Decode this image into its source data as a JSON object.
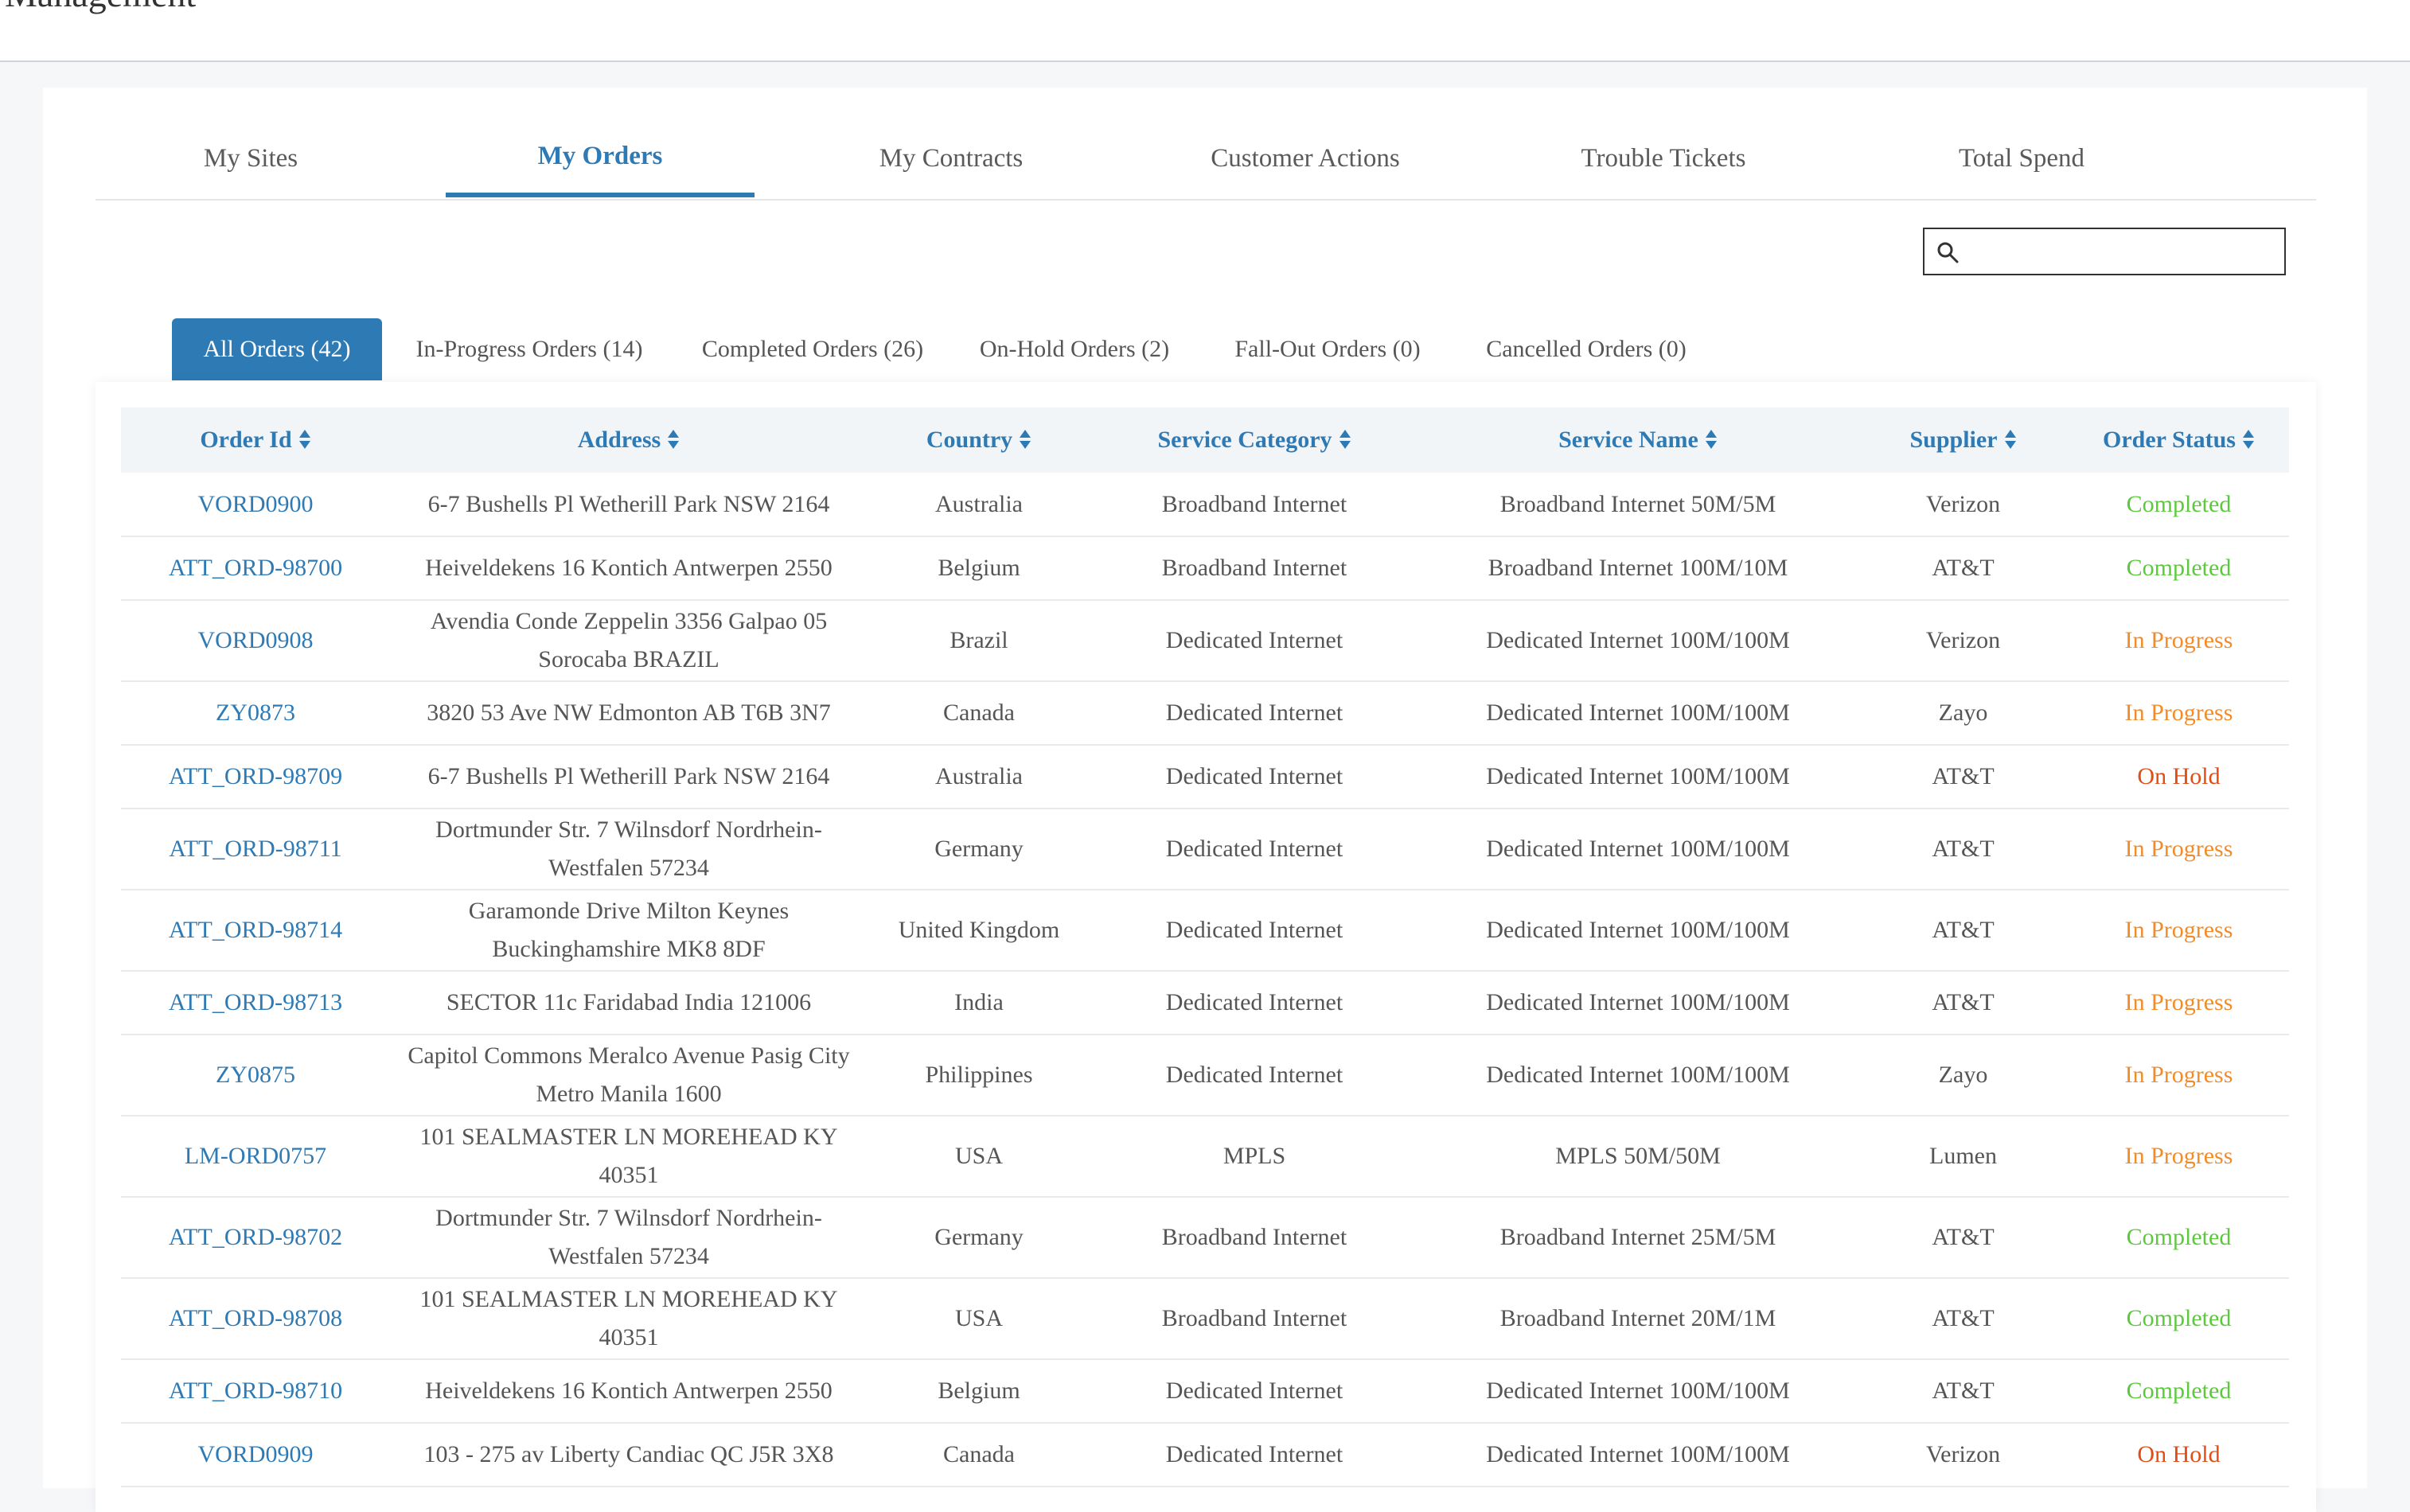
{
  "header": {
    "title": "Management"
  },
  "main_tabs": [
    {
      "label": "My Sites",
      "active": false
    },
    {
      "label": "My Orders",
      "active": true
    },
    {
      "label": "My Contracts",
      "active": false
    },
    {
      "label": "Customer Actions",
      "active": false
    },
    {
      "label": "Trouble Tickets",
      "active": false
    },
    {
      "label": "Total Spend",
      "active": false
    }
  ],
  "search": {
    "value": "",
    "icon": "search-icon"
  },
  "sub_tabs": [
    {
      "label": "All Orders (42)",
      "active": true
    },
    {
      "label": "In-Progress Orders (14)",
      "active": false
    },
    {
      "label": "Completed Orders (26)",
      "active": false
    },
    {
      "label": "On-Hold Orders (2)",
      "active": false
    },
    {
      "label": "Fall-Out Orders (0)",
      "active": false
    },
    {
      "label": "Cancelled Orders (0)",
      "active": false
    }
  ],
  "table": {
    "columns": [
      "Order Id",
      "Address",
      "Country",
      "Service Category",
      "Service Name",
      "Supplier",
      "Order Status"
    ],
    "status_colors": {
      "Completed": "#5cc93c",
      "In Progress": "#f28c28",
      "On Hold": "#e04e17"
    },
    "link_color": "#2e7ab5",
    "rows": [
      {
        "order_id": "VORD0900",
        "address": "6-7 Bushells Pl Wetherill Park NSW 2164",
        "country": "Australia",
        "service_category": "Broadband Internet",
        "service_name": "Broadband Internet 50M/5M",
        "supplier": "Verizon",
        "status": "Completed"
      },
      {
        "order_id": "ATT_ORD-98700",
        "address": "Heiveldekens 16 Kontich Antwerpen 2550",
        "country": "Belgium",
        "service_category": "Broadband Internet",
        "service_name": "Broadband Internet 100M/10M",
        "supplier": "AT&T",
        "status": "Completed"
      },
      {
        "order_id": "VORD0908",
        "address": "Avendia Conde Zeppelin 3356 Galpao 05 Sorocaba BRAZIL",
        "country": "Brazil",
        "service_category": "Dedicated Internet",
        "service_name": "Dedicated Internet 100M/100M",
        "supplier": "Verizon",
        "status": "In Progress"
      },
      {
        "order_id": "ZY0873",
        "address": "3820 53 Ave NW Edmonton AB T6B 3N7",
        "country": "Canada",
        "service_category": "Dedicated Internet",
        "service_name": "Dedicated Internet 100M/100M",
        "supplier": "Zayo",
        "status": "In Progress"
      },
      {
        "order_id": "ATT_ORD-98709",
        "address": "6-7 Bushells Pl Wetherill Park NSW 2164",
        "country": "Australia",
        "service_category": "Dedicated Internet",
        "service_name": "Dedicated Internet 100M/100M",
        "supplier": "AT&T",
        "status": "On Hold"
      },
      {
        "order_id": "ATT_ORD-98711",
        "address": "Dortmunder Str. 7 Wilnsdorf Nordrhein-Westfalen 57234",
        "country": "Germany",
        "service_category": "Dedicated Internet",
        "service_name": "Dedicated Internet 100M/100M",
        "supplier": "AT&T",
        "status": "In Progress"
      },
      {
        "order_id": "ATT_ORD-98714",
        "address": "Garamonde Drive Milton Keynes Buckinghamshire MK8 8DF",
        "country": "United Kingdom",
        "service_category": "Dedicated Internet",
        "service_name": "Dedicated Internet 100M/100M",
        "supplier": "AT&T",
        "status": "In Progress"
      },
      {
        "order_id": "ATT_ORD-98713",
        "address": "SECTOR 11c Faridabad India 121006",
        "country": "India",
        "service_category": "Dedicated Internet",
        "service_name": "Dedicated Internet 100M/100M",
        "supplier": "AT&T",
        "status": "In Progress"
      },
      {
        "order_id": "ZY0875",
        "address": "Capitol Commons Meralco Avenue Pasig City Metro Manila 1600",
        "country": "Philippines",
        "service_category": "Dedicated Internet",
        "service_name": "Dedicated Internet 100M/100M",
        "supplier": "Zayo",
        "status": "In Progress"
      },
      {
        "order_id": "LM-ORD0757",
        "address": "101 SEALMASTER LN MOREHEAD KY 40351",
        "country": "USA",
        "service_category": "MPLS",
        "service_name": "MPLS 50M/50M",
        "supplier": "Lumen",
        "status": "In Progress"
      },
      {
        "order_id": "ATT_ORD-98702",
        "address": "Dortmunder Str. 7 Wilnsdorf Nordrhein-Westfalen 57234",
        "country": "Germany",
        "service_category": "Broadband Internet",
        "service_name": "Broadband Internet 25M/5M",
        "supplier": "AT&T",
        "status": "Completed"
      },
      {
        "order_id": "ATT_ORD-98708",
        "address": "101 SEALMASTER LN MOREHEAD KY 40351",
        "country": "USA",
        "service_category": "Broadband Internet",
        "service_name": "Broadband Internet 20M/1M",
        "supplier": "AT&T",
        "status": "Completed"
      },
      {
        "order_id": "ATT_ORD-98710",
        "address": "Heiveldekens 16 Kontich Antwerpen 2550",
        "country": "Belgium",
        "service_category": "Dedicated Internet",
        "service_name": "Dedicated Internet 100M/100M",
        "supplier": "AT&T",
        "status": "Completed"
      },
      {
        "order_id": "VORD0909",
        "address": "103 - 275 av Liberty Candiac QC J5R 3X8",
        "country": "Canada",
        "service_category": "Dedicated Internet",
        "service_name": "Dedicated Internet 100M/100M",
        "supplier": "Verizon",
        "status": "On Hold"
      }
    ]
  }
}
